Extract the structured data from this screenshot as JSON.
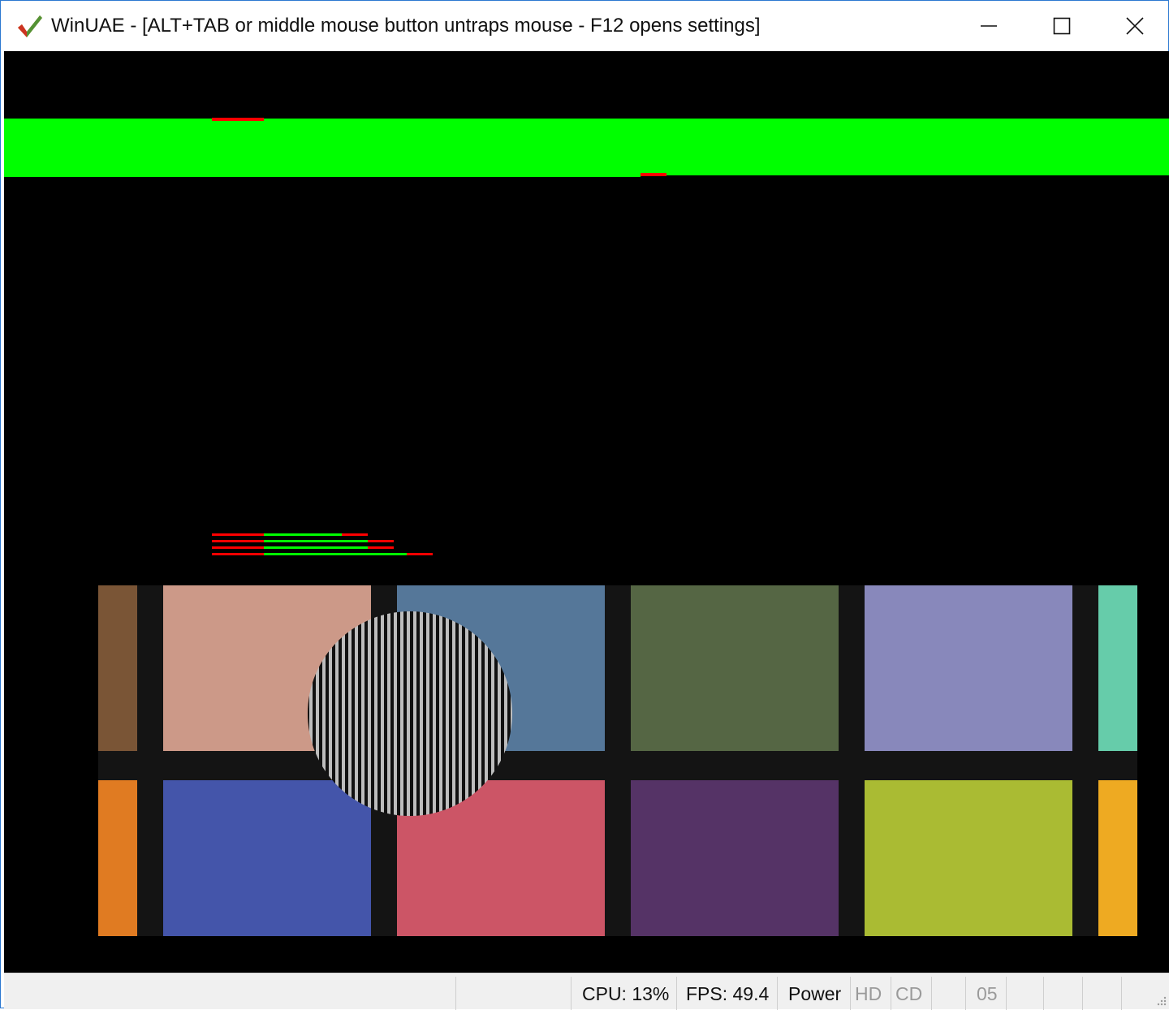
{
  "window": {
    "title": "WinUAE - [ALT+TAB or middle mouse button untraps mouse - F12 opens settings]",
    "controls": {
      "minimize": "minimize-icon",
      "maximize": "maximize-icon",
      "close": "close-icon"
    },
    "frame_color": "#2b78d1"
  },
  "display": {
    "background": "#000000",
    "top_bar_color": "#00ff00",
    "marker_color": "#ff0000",
    "palette_rows": [
      [
        "#7a5536",
        "#cc9988",
        "#557799",
        "#556644",
        "#8888bb",
        "#66ccaa"
      ],
      [
        "#e07b22",
        "#4455aa",
        "#cc5566",
        "#553366",
        "#aabb33",
        "#eeaa22"
      ]
    ],
    "grid_color": "#141414",
    "sprite": "striped-circle"
  },
  "statusbar": {
    "cpu": "CPU: 13%",
    "fps": "FPS: 49.4",
    "power": "Power",
    "hd": "HD",
    "cd": "CD",
    "drive": "05"
  }
}
